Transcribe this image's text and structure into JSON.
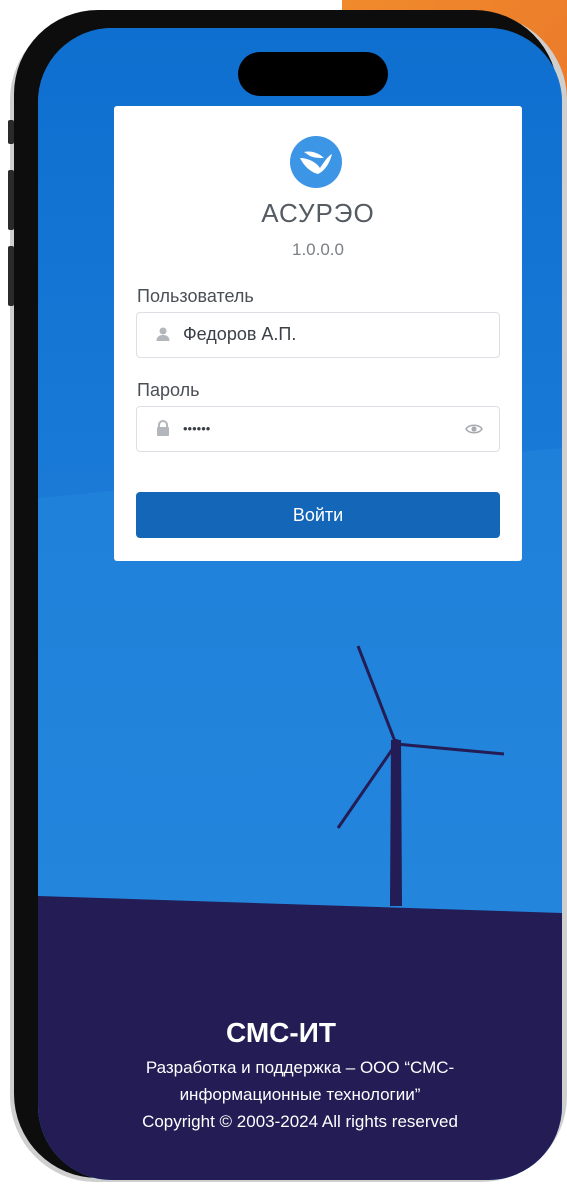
{
  "app": {
    "title": "АСУРЭО",
    "version": "1.0.0.0",
    "logo_icon": "dove-logo-icon"
  },
  "login": {
    "username_label": "Пользователь",
    "username_value": "Федоров А.П.",
    "username_icon": "user-icon",
    "password_label": "Пароль",
    "password_value": "••••••",
    "password_icon": "lock-icon",
    "show_password_icon": "eye-icon",
    "submit_label": "Войти"
  },
  "footer": {
    "company_logo_text": "СМС-ИТ",
    "line1": "Разработка и поддержка – ООО “СМС-",
    "line2": "информационные технологии”",
    "line3": "Copyright © 2003-2024 All rights reserved"
  },
  "colors": {
    "sky": "#1d7bd6",
    "ground": "#231c55",
    "button": "#1466b8",
    "accent_corner": "#ef8a2b"
  }
}
